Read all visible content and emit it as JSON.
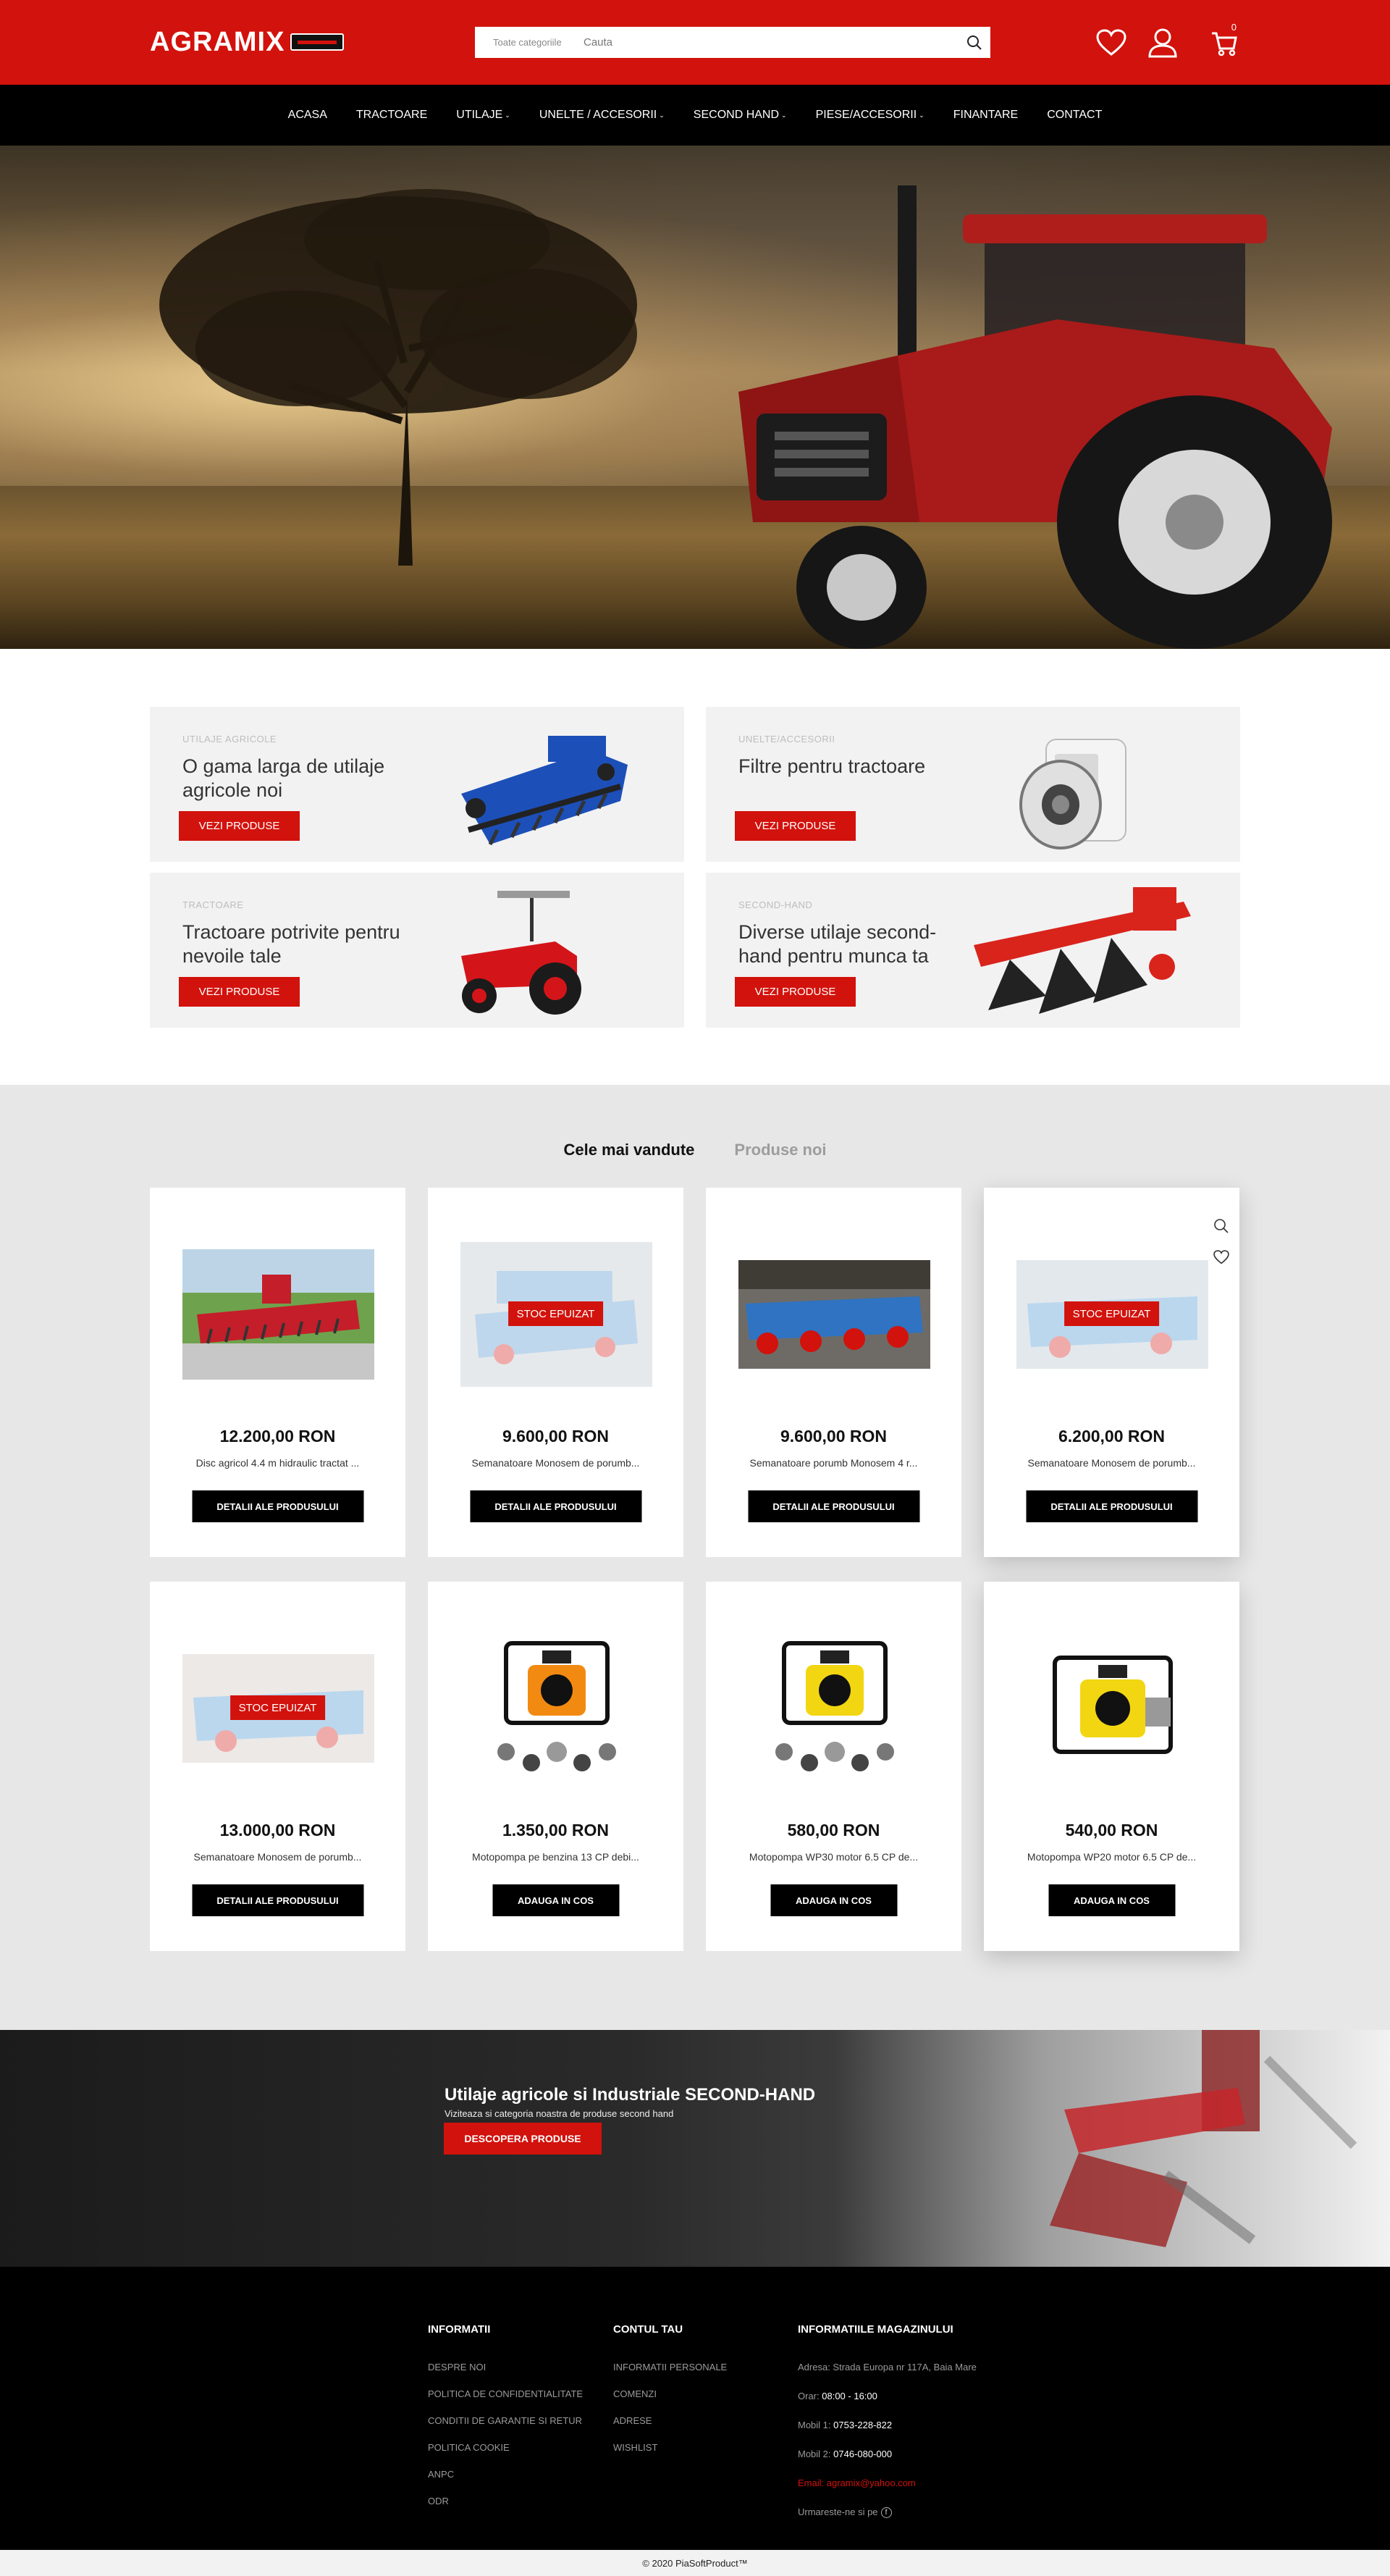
{
  "header": {
    "logo_text": "AGRAMIX",
    "search_category": "Toate categoriile",
    "search_placeholder": "Cauta",
    "cart_count": "0",
    "colors": {
      "brand_red": "#d2120c",
      "nav_bg": "#000000"
    }
  },
  "nav": {
    "items": [
      {
        "label": "ACASA",
        "has_dropdown": false
      },
      {
        "label": "TRACTOARE",
        "has_dropdown": false
      },
      {
        "label": "UTILAJE",
        "has_dropdown": true
      },
      {
        "label": "UNELTE / ACCESORII",
        "has_dropdown": true
      },
      {
        "label": "SECOND HAND",
        "has_dropdown": true
      },
      {
        "label": "PIESE/ACCESORII",
        "has_dropdown": true
      },
      {
        "label": "FINANTARE",
        "has_dropdown": false
      },
      {
        "label": "CONTACT",
        "has_dropdown": false
      }
    ]
  },
  "categories": [
    {
      "kicker": "UTILAJE AGRICOLE",
      "title": "O gama larga de utilaje agricole noi",
      "button": "VEZI PRODUSE",
      "icon": "cultivator-image"
    },
    {
      "kicker": "UNELTE/ACCESORII",
      "title": "Filtre pentru tractoare",
      "button": "VEZI PRODUSE",
      "icon": "oil-filter-image"
    },
    {
      "kicker": "TRACTOARE",
      "title": "Tractoare potrivite pentru nevoile tale",
      "button": "VEZI PRODUSE",
      "icon": "tractor-image"
    },
    {
      "kicker": "SECOND-HAND",
      "title": "Diverse utilaje second-hand pentru munca ta",
      "button": "VEZI PRODUSE",
      "icon": "plough-image"
    }
  ],
  "products": {
    "tabs": [
      {
        "label": "Cele mai vandute",
        "active": true
      },
      {
        "label": "Produse noi",
        "active": false
      }
    ],
    "items": [
      {
        "price": "12.200,00 RON",
        "name": "Disc agricol 4.4 m hidraulic tractat ...",
        "button": "DETALII ALE PRODUSULUI",
        "out_of_stock": false,
        "tag": ""
      },
      {
        "price": "9.600,00 RON",
        "name": "Semanatoare Monosem de porumb...",
        "button": "DETALII ALE PRODUSULUI",
        "out_of_stock": true,
        "tag": "STOC EPUIZAT"
      },
      {
        "price": "9.600,00 RON",
        "name": "Semanatoare porumb Monosem 4 r...",
        "button": "DETALII ALE PRODUSULUI",
        "out_of_stock": false,
        "tag": ""
      },
      {
        "price": "6.200,00 RON",
        "name": "Semanatoare Monosem de porumb...",
        "button": "DETALII ALE PRODUSULUI",
        "out_of_stock": true,
        "tag": "STOC EPUIZAT"
      },
      {
        "price": "13.000,00 RON",
        "name": "Semanatoare Monosem de porumb...",
        "button": "DETALII ALE PRODUSULUI",
        "out_of_stock": true,
        "tag": "STOC EPUIZAT"
      },
      {
        "price": "1.350,00 RON",
        "name": "Motopompa pe benzina 13 CP debi...",
        "button": "ADAUGA IN COS",
        "out_of_stock": false,
        "tag": ""
      },
      {
        "price": "580,00 RON",
        "name": "Motopompa WP30 motor 6.5 CP de...",
        "button": "ADAUGA IN COS",
        "out_of_stock": false,
        "tag": ""
      },
      {
        "price": "540,00 RON",
        "name": "Motopompa WP20 motor 6.5 CP de...",
        "button": "ADAUGA IN COS",
        "out_of_stock": false,
        "tag": ""
      }
    ]
  },
  "banner": {
    "title": "Utilaje agricole si Industriale SECOND-HAND",
    "subtitle": "Viziteaza si categoria noastra de produse second hand",
    "button": "DESCOPERA PRODUSE"
  },
  "footer": {
    "info": {
      "title": "INFORMATII",
      "links": [
        "DESPRE NOI",
        "POLITICA DE CONFIDENTIALITATE",
        "CONDITII DE GARANTIE SI RETUR",
        "POLITICA COOKIE",
        "ANPC",
        "ODR"
      ]
    },
    "account": {
      "title": "CONTUL TAU",
      "links": [
        "INFORMATII PERSONALE",
        "COMENZI",
        "ADRESE",
        "WISHLIST"
      ]
    },
    "store": {
      "title": "INFORMATIILE MAGAZINULUI",
      "address": "Adresa: Strada Europa nr 117A, Baia Mare",
      "hours_label": "Orar:",
      "hours": "08:00 - 16:00",
      "mobile1_label": "Mobil 1:",
      "mobile1": "0753-228-822",
      "mobile2_label": "Mobil 2:",
      "mobile2": "0746-080-000",
      "email": "Email: agramix@yahoo.com",
      "follow": "Urmareste-ne si pe"
    },
    "copyright": "© 2020 PiaSoftProduct™"
  }
}
